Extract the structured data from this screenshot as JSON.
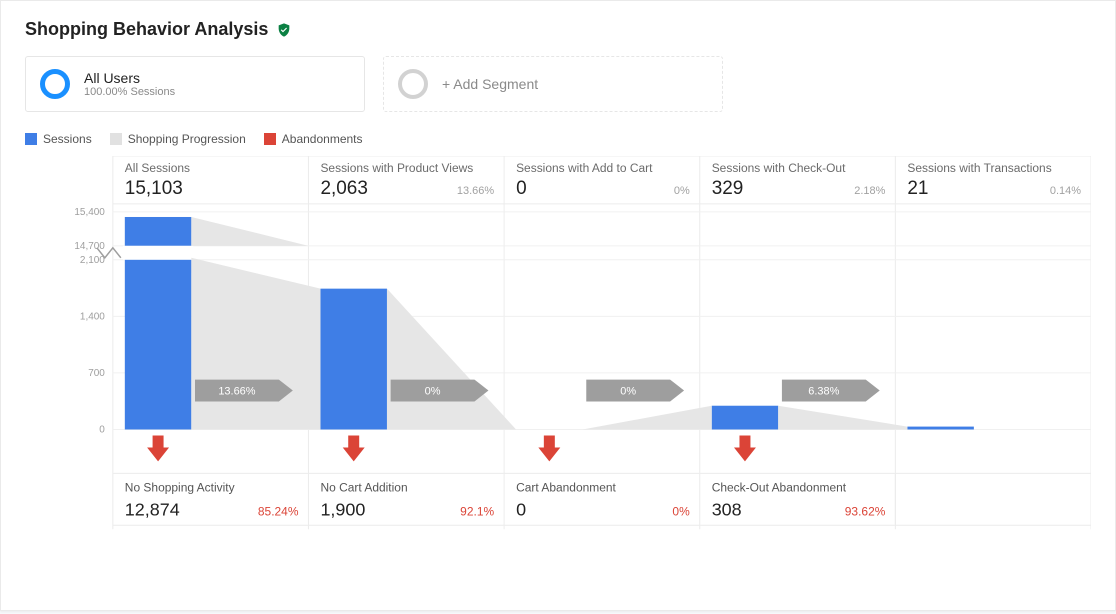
{
  "page_title": "Shopping Behavior Analysis",
  "segments": {
    "primary": {
      "title": "All Users",
      "sub": "100.00% Sessions"
    },
    "add": {
      "title": "+ Add Segment"
    }
  },
  "legend": {
    "sessions": "Sessions",
    "progression": "Shopping Progression",
    "abandon": "Abandonments"
  },
  "colors": {
    "sessions": "#3f7ee6",
    "progression": "#e1e1e1",
    "abandon": "#db4437"
  },
  "chart_data": {
    "type": "bar",
    "title": "Shopping Behavior Analysis funnel",
    "steps": [
      {
        "label": "All Sessions",
        "value": 15103,
        "value_fmt": "15,103",
        "pct": null,
        "pct_fmt": "",
        "flow_to_next_pct": "13.66%",
        "abandon_label": "No Shopping Activity",
        "abandon_value": 12874,
        "abandon_fmt": "12,874",
        "abandon_pct": "85.24%"
      },
      {
        "label": "Sessions with Product Views",
        "value": 2063,
        "value_fmt": "2,063",
        "pct": 13.66,
        "pct_fmt": "13.66%",
        "flow_to_next_pct": "0%",
        "abandon_label": "No Cart Addition",
        "abandon_value": 1900,
        "abandon_fmt": "1,900",
        "abandon_pct": "92.1%"
      },
      {
        "label": "Sessions with Add to Cart",
        "value": 0,
        "value_fmt": "0",
        "pct": 0,
        "pct_fmt": "0%",
        "flow_to_next_pct": "0%",
        "abandon_label": "Cart Abandonment",
        "abandon_value": 0,
        "abandon_fmt": "0",
        "abandon_pct": "0%"
      },
      {
        "label": "Sessions with Check-Out",
        "value": 329,
        "value_fmt": "329",
        "pct": 2.18,
        "pct_fmt": "2.18%",
        "flow_to_next_pct": "6.38%",
        "abandon_label": "Check-Out Abandonment",
        "abandon_value": 308,
        "abandon_fmt": "308",
        "abandon_pct": "93.62%"
      },
      {
        "label": "Sessions with Transactions",
        "value": 21,
        "value_fmt": "21",
        "pct": 0.14,
        "pct_fmt": "0.14%",
        "flow_to_next_pct": null,
        "abandon_label": null,
        "abandon_value": null,
        "abandon_fmt": null,
        "abandon_pct": null
      }
    ],
    "y_axis": {
      "upper": {
        "ticks": [
          14700,
          15400
        ],
        "total": 15103
      },
      "lower": {
        "ticks": [
          0,
          700,
          1400,
          2100
        ],
        "max": 2100
      }
    },
    "bar_second_scale_fraction": {
      "_comment": "approx fraction of lower plotting band height occupied by each bar (visual estimate)",
      "values": [
        1.03,
        0.83,
        0.0,
        0.14,
        0.017
      ]
    }
  }
}
